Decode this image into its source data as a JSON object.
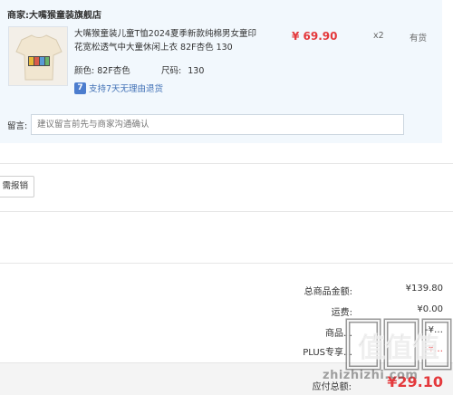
{
  "merchant": {
    "label": "商家:",
    "name": "大嘴猴童装旗舰店"
  },
  "product": {
    "name": "大嘴猴童装儿童T恤2024夏季新款纯棉男女童印花宽松透气中大童休闲上衣 82F杏色 130",
    "price": "¥ 69.90",
    "quantity": "x2",
    "stock_status": "有货",
    "color_label": "颜色:",
    "color_value": "82F杏色",
    "size_label": "尺码:",
    "size_value": "130",
    "service_icon": "7",
    "service_text": "支持7天无理由退货"
  },
  "note": {
    "label": "留言:",
    "placeholder": "建议留言前先与商家沟通确认"
  },
  "reimburse_button": "需报销",
  "summary": {
    "goods_total_label": "总商品金额:",
    "goods_total_value": "¥139.80",
    "shipping_label": "运费:",
    "shipping_value": "¥0.00",
    "row3_label": "商品…",
    "row3_value": "-¥…",
    "plus_label": "PLUS专享…",
    "plus_value": "-¥…",
    "payable_label": "应付总额:",
    "payable_value": "¥29.10"
  },
  "watermark": {
    "text": "zhizhizhi.com",
    "glyphs": "值值值"
  },
  "colors": {
    "accent_red": "#e4393c",
    "panel_bg": "#f2f8fd",
    "service_blue": "#4c7dce"
  }
}
